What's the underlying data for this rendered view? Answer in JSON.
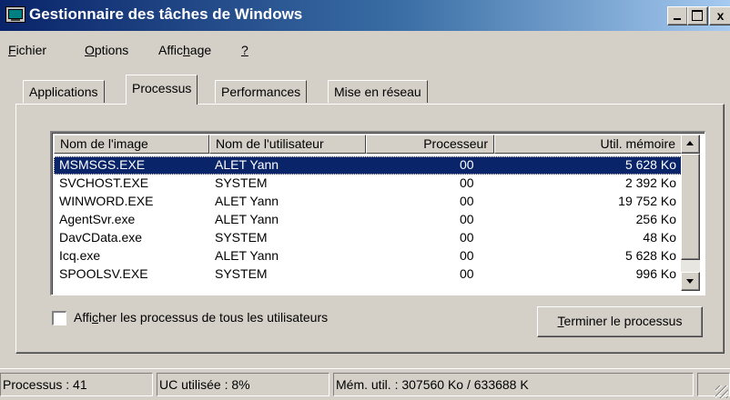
{
  "window": {
    "title": "Gestionnaire des tâches de Windows",
    "min_label": "_",
    "close_label": "x"
  },
  "menu": {
    "fichier_rest": "ichier",
    "fichier_u": "F",
    "options_rest": "ptions",
    "options_u": "O",
    "affichage_pre": "Affic",
    "affichage_u": "h",
    "affichage_post": "age",
    "help_u": "?"
  },
  "tabs": [
    "Applications",
    "Processus",
    "Performances",
    "Mise en réseau"
  ],
  "columns": [
    "Nom de l'image",
    "Nom de l'utilisateur",
    "Processeur",
    "Util. mémoire"
  ],
  "rows": [
    {
      "name": "MSMSGS.EXE",
      "user": "ALET Yann",
      "cpu": "00",
      "mem": "5 628 Ko"
    },
    {
      "name": "SVCHOST.EXE",
      "user": "SYSTEM",
      "cpu": "00",
      "mem": "2 392 Ko"
    },
    {
      "name": "WINWORD.EXE",
      "user": "ALET Yann",
      "cpu": "00",
      "mem": "19 752 Ko"
    },
    {
      "name": "AgentSvr.exe",
      "user": "ALET Yann",
      "cpu": "00",
      "mem": "256 Ko"
    },
    {
      "name": "DavCData.exe",
      "user": "SYSTEM",
      "cpu": "00",
      "mem": "48 Ko"
    },
    {
      "name": "Icq.exe",
      "user": "ALET Yann",
      "cpu": "00",
      "mem": "5 628 Ko"
    },
    {
      "name": "SPOOLSV.EXE",
      "user": "SYSTEM",
      "cpu": "00",
      "mem": "996 Ko"
    }
  ],
  "checkbox": {
    "pre": "Affi",
    "u": "c",
    "post": "her les processus de tous les utilisateurs"
  },
  "end_button": {
    "u": "T",
    "rest": "erminer le processus"
  },
  "status": {
    "processes": "Processus : 41",
    "cpu": "UC utilisée : 8%",
    "memory": "Mém. util. : 307560 Ko / 633688 K"
  },
  "colors": {
    "title_start": "#0a246a",
    "title_end": "#a6caf0",
    "selection": "#0a246a",
    "face": "#d4d0c8"
  }
}
